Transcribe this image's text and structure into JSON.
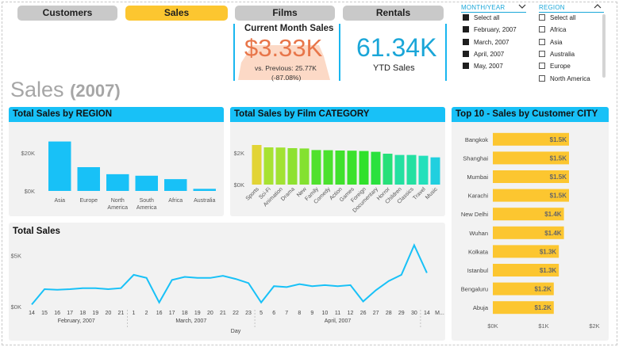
{
  "nav": {
    "tabs": [
      {
        "label": "Customers",
        "active": false
      },
      {
        "label": "Sales",
        "active": true
      },
      {
        "label": "Films",
        "active": false
      },
      {
        "label": "Rentals",
        "active": false
      }
    ]
  },
  "kpi": {
    "current_month": {
      "title": "Current Month Sales",
      "value": "$3.33K",
      "previous": "vs. Previous: 25.77K",
      "change": "(-87.08%)",
      "color": "#e8764a"
    },
    "ytd": {
      "value": "61.34K",
      "label": "YTD Sales",
      "color": "#1aa6d8"
    }
  },
  "slicers": {
    "month_year": {
      "title": "MONTH/YEAR",
      "items": [
        {
          "label": "Select all",
          "checked": true
        },
        {
          "label": "February, 2007",
          "checked": true
        },
        {
          "label": "March, 2007",
          "checked": true
        },
        {
          "label": "April, 2007",
          "checked": true
        },
        {
          "label": "May, 2007",
          "checked": true
        }
      ]
    },
    "region": {
      "title": "REGION",
      "items": [
        {
          "label": "Select all",
          "checked": false
        },
        {
          "label": "Africa",
          "checked": false
        },
        {
          "label": "Asia",
          "checked": false
        },
        {
          "label": "Australia",
          "checked": false
        },
        {
          "label": "Europe",
          "checked": false
        },
        {
          "label": "North America",
          "checked": false
        }
      ]
    }
  },
  "page_title": {
    "main": "Sales",
    "year": "(2007)"
  },
  "colors": {
    "accent": "#18c1f7",
    "line": "#18c1f7",
    "city_bar": "#fcc630",
    "tab_active": "#fcc630",
    "tab_inactive": "#c9c9c9"
  },
  "charts": {
    "region": {
      "title": "Total Sales by REGION",
      "yticks": [
        "$20K",
        "$0K"
      ]
    },
    "category": {
      "title": "Total Sales by Film CATEGORY",
      "yticks": [
        "$2K",
        "$0K"
      ]
    },
    "city": {
      "title": "Top 10 - Sales by Customer CITY",
      "xticks": [
        "$0K",
        "$1K",
        "$2K"
      ]
    },
    "total": {
      "title": "Total Sales",
      "yticks": [
        "$5K",
        "$0K"
      ],
      "months": [
        "February, 2007",
        "March, 2007",
        "April, 2007"
      ],
      "xlabel": "Day"
    }
  },
  "chart_data": [
    {
      "type": "bar",
      "title": "Total Sales by REGION",
      "categories": [
        "Asia",
        "Europe",
        "North America",
        "South America",
        "Africa",
        "Australia"
      ],
      "values": [
        26000,
        12500,
        8800,
        8000,
        6200,
        1100
      ],
      "ylim": [
        0,
        30000
      ],
      "ylabel": "",
      "xlabel": "",
      "grid": false
    },
    {
      "type": "bar",
      "title": "Total Sales by Film CATEGORY",
      "categories": [
        "Sports",
        "Sci-Fi",
        "Animation",
        "Drama",
        "New",
        "Family",
        "Comedy",
        "Action",
        "Games",
        "Foreign",
        "Documentary",
        "Horror",
        "Children",
        "Classics",
        "Travel",
        "Music"
      ],
      "values": [
        2500,
        2350,
        2340,
        2300,
        2280,
        2180,
        2170,
        2150,
        2140,
        2120,
        2070,
        1950,
        1870,
        1870,
        1820,
        1720
      ],
      "ylim": [
        0,
        3000
      ],
      "grid": false
    },
    {
      "type": "bar",
      "orientation": "horizontal",
      "title": "Top 10 - Sales by Customer CITY",
      "categories": [
        "Bangkok",
        "Shanghai",
        "Mumbai",
        "Karachi",
        "New Delhi",
        "Wuhan",
        "Kolkata",
        "Istanbul",
        "Bengaluru",
        "Abuja"
      ],
      "values": [
        1500,
        1500,
        1500,
        1500,
        1400,
        1400,
        1300,
        1300,
        1200,
        1200
      ],
      "labels": [
        "$1.5K",
        "$1.5K",
        "$1.5K",
        "$1.5K",
        "$1.4K",
        "$1.4K",
        "$1.3K",
        "$1.3K",
        "$1.2K",
        "$1.2K"
      ],
      "xlim": [
        0,
        2000
      ]
    },
    {
      "type": "line",
      "title": "Total Sales",
      "x": [
        "14",
        "15",
        "16",
        "17",
        "18",
        "19",
        "20",
        "21",
        "1",
        "2",
        "16",
        "17",
        "18",
        "19",
        "20",
        "21",
        "22",
        "23",
        "5",
        "6",
        "7",
        "8",
        "9",
        "10",
        "11",
        "12",
        "26",
        "27",
        "28",
        "29",
        "30",
        "14",
        "15"
      ],
      "tick_labels": [
        "14",
        "15",
        "16",
        "17",
        "18",
        "19",
        "20",
        "21",
        "1",
        "2",
        "16",
        "17",
        "18",
        "19",
        "20",
        "21",
        "22",
        "23",
        "5",
        "6",
        "7",
        "8",
        "9",
        "10",
        "11",
        "12",
        "26",
        "27",
        "28",
        "29",
        "30",
        "14",
        "M..."
      ],
      "values": [
        200,
        1700,
        1650,
        1700,
        1800,
        1800,
        1700,
        1800,
        3100,
        2800,
        400,
        2600,
        2900,
        2800,
        2800,
        3000,
        2700,
        2300,
        400,
        2000,
        1900,
        2200,
        2000,
        2100,
        2000,
        2100,
        500,
        1600,
        2500,
        3100,
        6000,
        3300
      ],
      "ylim": [
        0,
        6500
      ],
      "xlabel": "Day"
    }
  ]
}
